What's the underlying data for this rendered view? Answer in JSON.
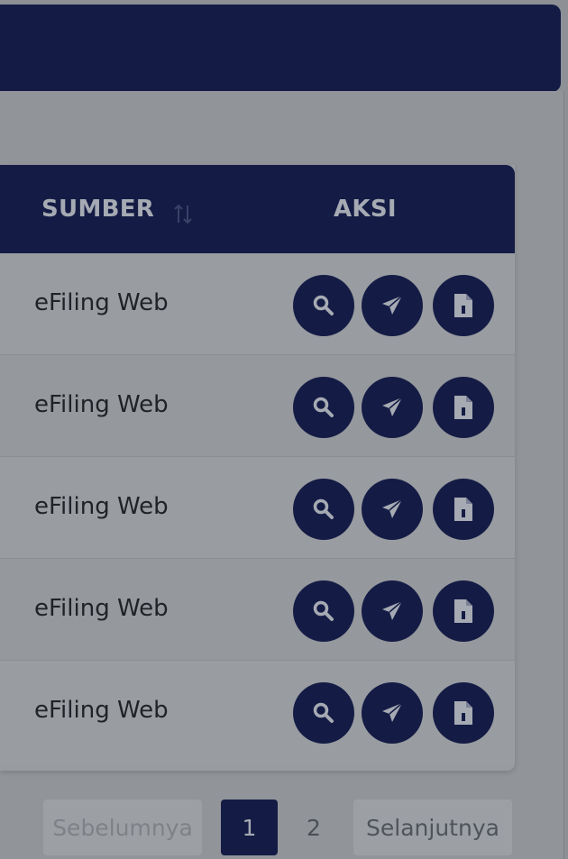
{
  "table": {
    "headers": {
      "sumber": "SUMBER",
      "aksi": "AKSI"
    },
    "rows": [
      {
        "sumber": "eFiling Web"
      },
      {
        "sumber": "eFiling Web"
      },
      {
        "sumber": "eFiling Web"
      },
      {
        "sumber": "eFiling Web"
      },
      {
        "sumber": "eFiling Web"
      }
    ],
    "action_icons": [
      "search-icon",
      "send-icon",
      "document-icon"
    ]
  },
  "pagination": {
    "prev_label": "Sebelumnya",
    "pages": [
      "1",
      "2"
    ],
    "current_page": "1",
    "next_label": "Selanjutnya"
  },
  "colors": {
    "navy": "#141c45",
    "overlay_gray": "#8d9196"
  }
}
